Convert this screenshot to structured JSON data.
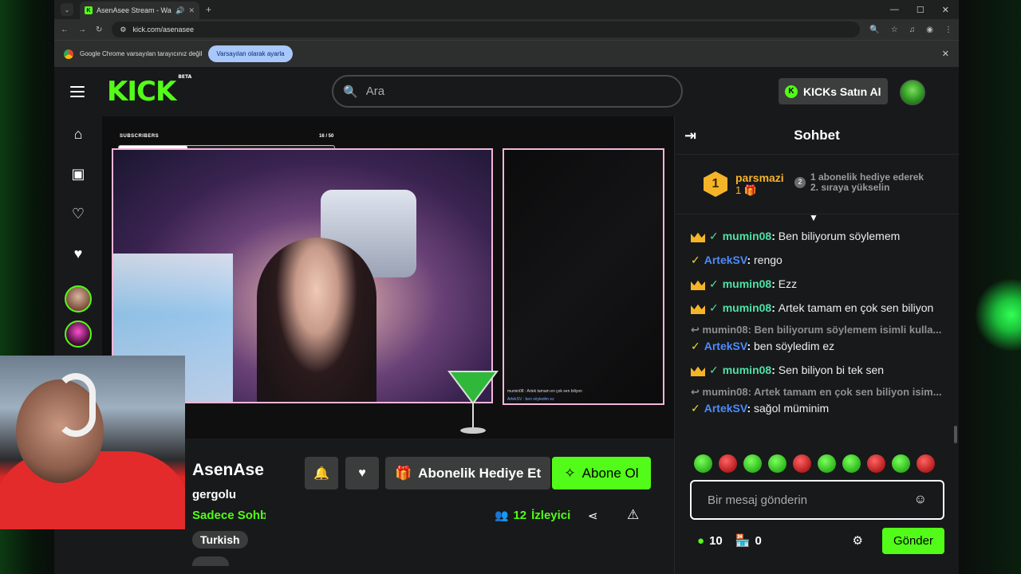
{
  "browser": {
    "tab_title": "AsenAsee Stream - Watch L",
    "url": "kick.com/asenasee",
    "info_message": "Google Chrome varsayılan tarayıcınız değil",
    "info_button": "Varsayılan olarak ayarla"
  },
  "header": {
    "logo": "KICK",
    "beta": "BETA",
    "search_placeholder": "Ara",
    "buy_kicks": "KICKs Satın Al"
  },
  "stream_overlay": {
    "subscribers_label": "SUBSCRIBERS",
    "subscribers_count": "16 / 50",
    "subscribers_progress": 0.32,
    "overlay_msg_1": "mumin08 : Artek tamam en çok sen biliyon",
    "overlay_msg_2": "ArtekSV : ben söyledim ez"
  },
  "channel": {
    "name": "AsenAse",
    "game": "gergolu",
    "category": "Sadece Sohb",
    "tag": "Turkish",
    "gift_button": "Abonelik Hediye Et",
    "subscribe_button": "Abone Ol",
    "viewer_count": "12",
    "viewer_label": "İzleyici"
  },
  "chat": {
    "title": "Sohbet",
    "top_gifter": {
      "rank": "1",
      "name": "parsmazi",
      "count": "1"
    },
    "gift_hint_line1": "1 abonelik hediye ederek",
    "gift_hint_line2": "2. sıraya yükselin",
    "gift_hint_badge": "2",
    "messages": [
      {
        "user": "mumin08",
        "text": "Ben biliyorum söylemem"
      },
      {
        "user": "ArtekSV",
        "text": "rengo"
      },
      {
        "user": "mumin08",
        "text": "Ezz"
      },
      {
        "user": "mumin08",
        "text": "Artek tamam en çok sen biliyon"
      },
      {
        "reply": "mumin08: Ben biliyorum söylemem isimli kulla...",
        "user": "ArtekSV",
        "text": "ben söyledim ez"
      },
      {
        "user": "mumin08",
        "text": "Sen biliyon bi tek sen"
      },
      {
        "reply": "mumin08: Artek tamam en çok sen biliyon isim...",
        "user": "ArtekSV",
        "text": "sağol müminim"
      }
    ],
    "input_placeholder": "Bir mesaj gönderin",
    "kicks_count": "10",
    "store_count": "0",
    "send_button": "Gönder"
  },
  "colors": {
    "brand": "#53fc18",
    "gold": "#f5b428",
    "mod_name": "#4fe1a6",
    "user_name": "#4b8cff"
  }
}
